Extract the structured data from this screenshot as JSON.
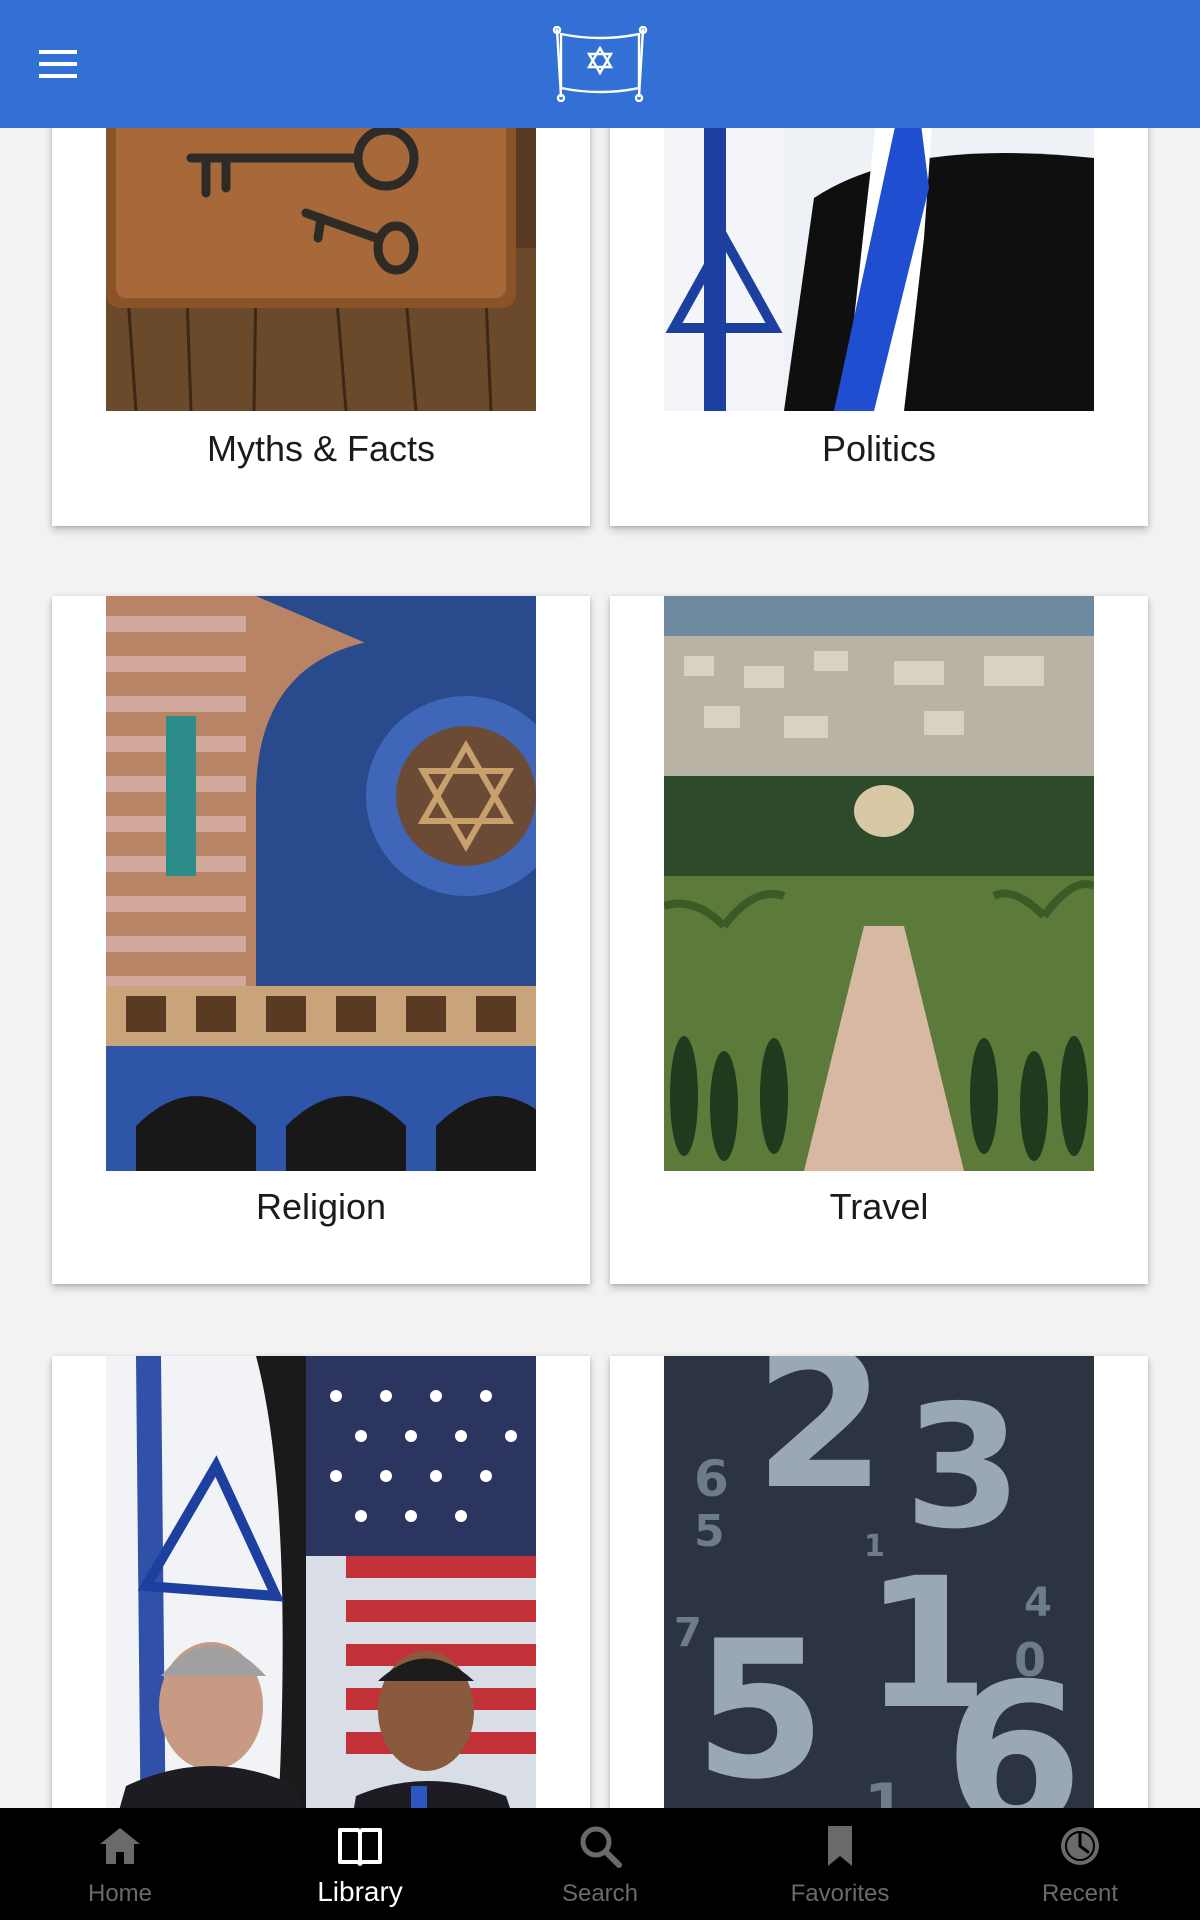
{
  "app_bar": {
    "menu_icon": "hamburger-menu-icon",
    "logo_icon": "scroll-star-of-david-logo",
    "color": "#3370d6"
  },
  "cards": [
    {
      "label": "Myths & Facts",
      "image": "old-keys-on-leather-book"
    },
    {
      "label": "Politics",
      "image": "man-in-suit-with-israeli-flag"
    },
    {
      "label": "Religion",
      "image": "ornate-synagogue-facade"
    },
    {
      "label": "Travel",
      "image": "terraced-gardens-overlooking-city"
    },
    {
      "label": "",
      "image": "two-leaders-before-israeli-and-us-flags"
    },
    {
      "label": "",
      "image": "large-numbers-background"
    }
  ],
  "bottom_nav": {
    "items": [
      {
        "label": "Home",
        "icon": "home-icon",
        "active": false
      },
      {
        "label": "Library",
        "icon": "book-icon",
        "active": true
      },
      {
        "label": "Search",
        "icon": "search-icon",
        "active": false
      },
      {
        "label": "Favorites",
        "icon": "bookmark-icon",
        "active": false
      },
      {
        "label": "Recent",
        "icon": "clock-icon",
        "active": false
      }
    ],
    "active_color": "#ffffff",
    "inactive_color": "#6a6a6a"
  }
}
